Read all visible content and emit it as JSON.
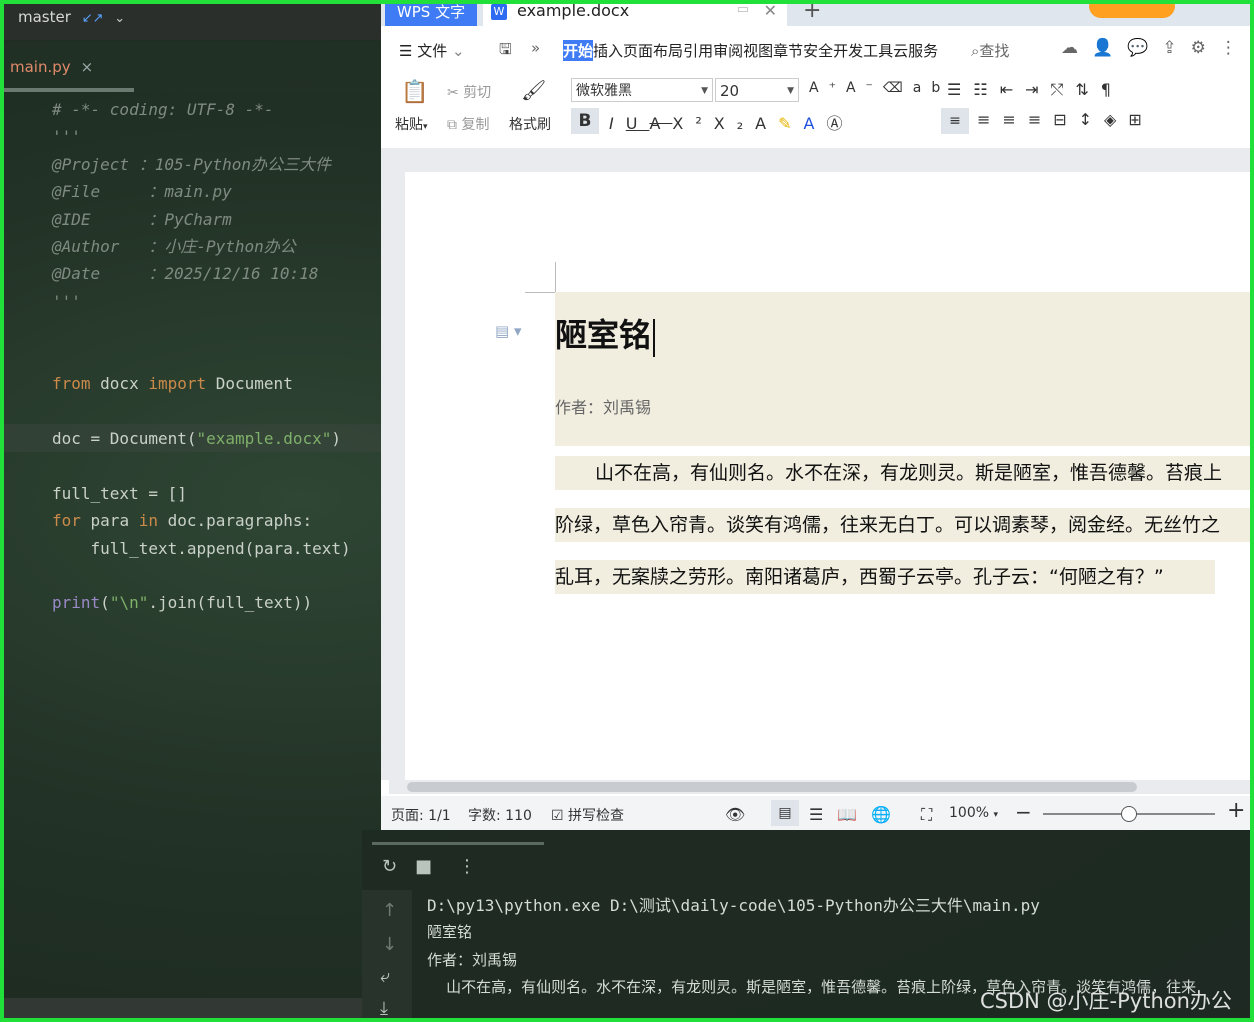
{
  "ide": {
    "branch": "master",
    "file_tab": "main.py",
    "code_lines": [
      {
        "cls": "c-com",
        "text": "# -*- coding: UTF-8 -*-"
      },
      {
        "cls": "c-com",
        "text": "'''"
      },
      {
        "cls": "c-com",
        "text": "@Project ：105-Python办公三大件"
      },
      {
        "cls": "c-com",
        "text": "@File     ：main.py"
      },
      {
        "cls": "c-com",
        "text": "@IDE      ：PyCharm"
      },
      {
        "cls": "c-com",
        "text": "@Author   ：小庄-Python办公"
      },
      {
        "cls": "c-com",
        "text": "@Date     ：2025/12/16 10:18"
      },
      {
        "cls": "c-com",
        "text": "'''"
      },
      {
        "cls": "",
        "text": ""
      },
      {
        "cls": "",
        "text": ""
      },
      {
        "cls": "kwline",
        "text": "from docx import Document"
      },
      {
        "cls": "",
        "text": ""
      },
      {
        "cls": "docline",
        "text": "doc = Document(\"example.docx\")"
      },
      {
        "cls": "",
        "text": ""
      },
      {
        "cls": "",
        "text": "full_text = []"
      },
      {
        "cls": "forline",
        "text": "for para in doc.paragraphs:"
      },
      {
        "cls": "",
        "text": "    full_text.append(para.text)"
      },
      {
        "cls": "",
        "text": ""
      },
      {
        "cls": "printline",
        "text": "print(\"\\n\".join(full_text))"
      }
    ]
  },
  "wps": {
    "app_label": "WPS 文字",
    "doc_tab": "example.docx",
    "menu_file": "文件",
    "menus": [
      "开始",
      "插入",
      "页面",
      "布局",
      "引用",
      "审阅",
      "视图",
      "章节",
      "安全",
      "开发工具",
      "云服务"
    ],
    "search": "查找",
    "ribbon": {
      "paste": "粘贴",
      "cut": "剪切",
      "copy": "复制",
      "format_painter": "格式刷",
      "font": "微软雅黑",
      "size": "20"
    },
    "document": {
      "title": "陋室铭",
      "author": "作者：刘禹锡",
      "lines": [
        "山不在高，有仙则名。水不在深，有龙则灵。斯是陋室，惟吾德馨。苔痕上",
        "阶绿，草色入帘青。谈笑有鸿儒，往来无白丁。可以调素琴，阅金经。无丝竹之",
        "乱耳，无案牍之劳形。南阳诸葛庐，西蜀子云亭。孔子云：“何陋之有？”"
      ]
    },
    "status": {
      "page": "页面: 1/1",
      "words": "字数: 110",
      "spell": "拼写检查",
      "zoom": "100%"
    }
  },
  "console": {
    "lines": [
      "D:\\py13\\python.exe D:\\测试\\daily-code\\105-Python办公三大件\\main.py",
      "陋室铭",
      "作者：刘禹锡",
      "    山不在高，有仙则名。水不在深，有龙则灵。斯是陋室，惟吾德馨。苔痕上阶绿，草色入帘青。谈笑有鸿儒，往来"
    ]
  },
  "watermark": "CSDN @小庄-Python办公"
}
